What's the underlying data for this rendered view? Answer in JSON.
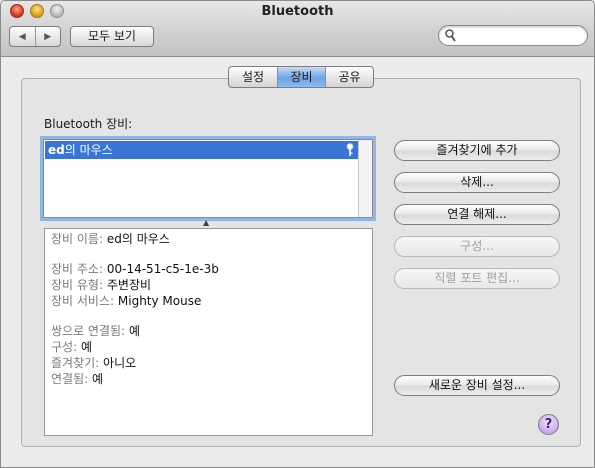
{
  "window": {
    "title": "Bluetooth"
  },
  "toolbar": {
    "back_glyph": "◀",
    "forward_glyph": "▶",
    "show_all_label": "모두 보기",
    "search_placeholder": "",
    "search_value": ""
  },
  "tabs": [
    {
      "label": "설정",
      "selected": false
    },
    {
      "label": "장비",
      "selected": true
    },
    {
      "label": "공유",
      "selected": false
    }
  ],
  "devices_section": {
    "label": "Bluetooth 장비:",
    "devices": [
      {
        "name_bold": "ed",
        "name_rest": "의 마우스",
        "selected": true,
        "icon": "key-icon"
      }
    ]
  },
  "info": {
    "name": {
      "label": "장비 이름:",
      "value": "ed의 마우스"
    },
    "address": {
      "label": "장비 주소:",
      "value": "00-14-51-c5-1e-3b"
    },
    "type": {
      "label": "장비 유형:",
      "value": "주변장비"
    },
    "services": {
      "label": "장비 서비스:",
      "value": "Mighty Mouse"
    },
    "paired": {
      "label": "쌍으로 연결됨:",
      "value": "예"
    },
    "configured": {
      "label": "구성:",
      "value": "예"
    },
    "favorite": {
      "label": "즐겨찾기:",
      "value": "아니오"
    },
    "connected": {
      "label": "연결됨:",
      "value": "예"
    }
  },
  "buttons": {
    "add_favorite": "즐겨찾기에 추가",
    "delete": "삭제...",
    "disconnect": "연결 해제...",
    "configure": "구성...",
    "edit_serial_ports": "직렬 포트 편집...",
    "setup_new_device": "새로운 장비 설정..."
  },
  "help": {
    "glyph": "?"
  },
  "colors": {
    "selection": "#3875d7",
    "tab_selected": "#6fa4e3",
    "help": "#c9a6f0"
  }
}
